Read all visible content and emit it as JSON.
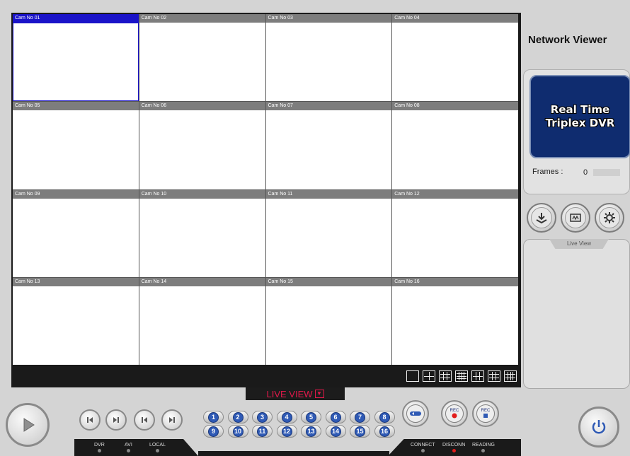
{
  "app_title": "Network Viewer",
  "logo": {
    "line1": "Real Time",
    "line2": "Triplex DVR",
    "bg_color": "#0f2c6f"
  },
  "frames": {
    "label": "Frames :",
    "value": "0"
  },
  "cameras": [
    "Cam No 01",
    "Cam No 02",
    "Cam No 03",
    "Cam No 04",
    "Cam No 05",
    "Cam No 06",
    "Cam No 07",
    "Cam No 08",
    "Cam No 09",
    "Cam No 10",
    "Cam No 11",
    "Cam No 12",
    "Cam No 13",
    "Cam No 14",
    "Cam No 15",
    "Cam No 16"
  ],
  "selected_camera": "Cam No 01",
  "selected_color": "#1a13c9",
  "live_view_label": "LIVE VIEW",
  "live_view_tab": "Live View",
  "numbers": [
    "1",
    "2",
    "3",
    "4",
    "5",
    "6",
    "7",
    "8",
    "9",
    "10",
    "11",
    "12",
    "13",
    "14",
    "15",
    "16"
  ],
  "rec_buttons": [
    {
      "icon": "dvr-icon",
      "label": ""
    },
    {
      "icon": "rec-red-icon",
      "label": "REC"
    },
    {
      "icon": "rec-blue-icon",
      "label": "REC"
    }
  ],
  "status_left": [
    {
      "label": "DVR",
      "active": false
    },
    {
      "label": "AVI",
      "active": false
    },
    {
      "label": "LOCAL",
      "active": false
    }
  ],
  "status_right": [
    {
      "label": "CONNECT",
      "active": false
    },
    {
      "label": "DISCONN",
      "active": true
    },
    {
      "label": "READING",
      "active": false
    }
  ],
  "accent_color": "#e1184a",
  "number_color": "#2f5ab5"
}
